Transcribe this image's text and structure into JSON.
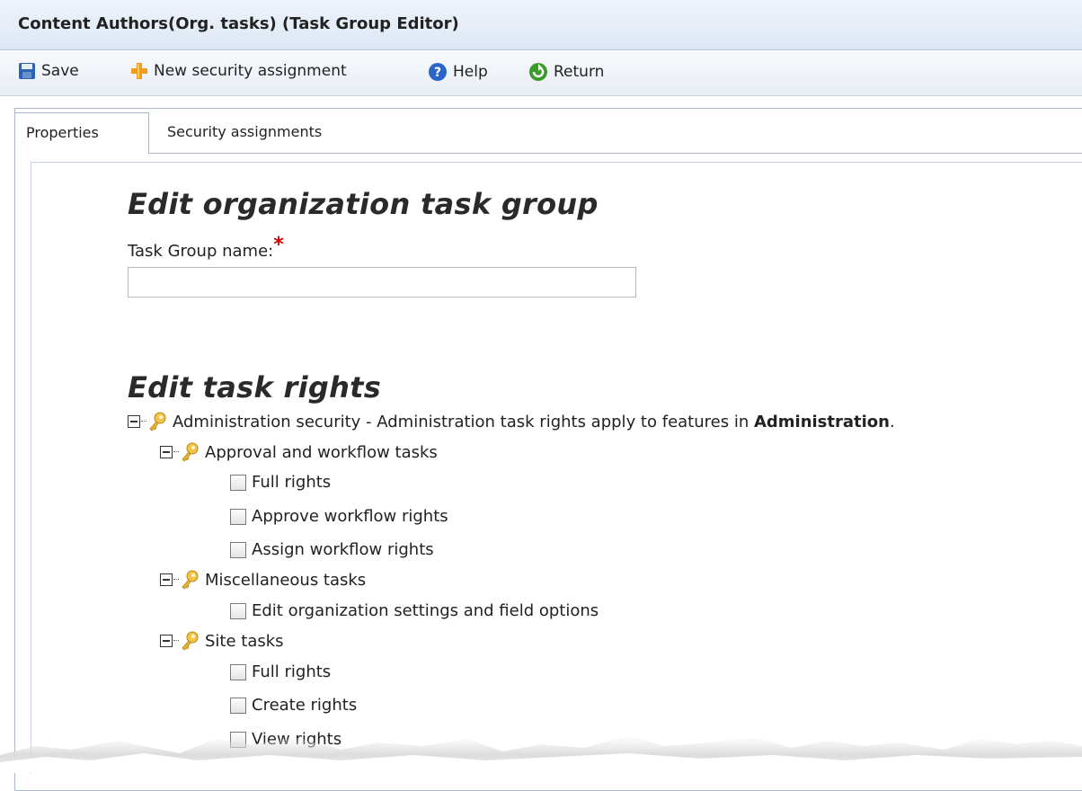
{
  "window": {
    "title": "Content Authors(Org. tasks) (Task Group Editor)"
  },
  "toolbar": {
    "save_label": "Save",
    "new_security_label": "New security assignment",
    "help_label": "Help",
    "return_label": "Return"
  },
  "tabs": [
    {
      "label": "Properties",
      "active": true
    },
    {
      "label": "Security assignments",
      "active": false
    }
  ],
  "form": {
    "heading": "Edit organization task group",
    "name_label": "Task Group name:",
    "required_marker": "*",
    "name_value": ""
  },
  "rights": {
    "heading": "Edit task rights",
    "root": {
      "label": "Administration security - Administration task rights apply to features in ",
      "label_bold": "Administration",
      "label_end": "."
    },
    "groups": [
      {
        "label": "Approval and workflow tasks",
        "items": [
          "Full rights",
          "Approve workflow rights",
          "Assign workflow rights"
        ]
      },
      {
        "label": "Miscellaneous tasks",
        "items": [
          "Edit organization settings and field options"
        ]
      },
      {
        "label": "Site tasks",
        "items": [
          "Full rights",
          "Create rights",
          "View rights"
        ]
      }
    ]
  },
  "colors": {
    "required": "#d40000",
    "accent": "#1a66c2"
  }
}
